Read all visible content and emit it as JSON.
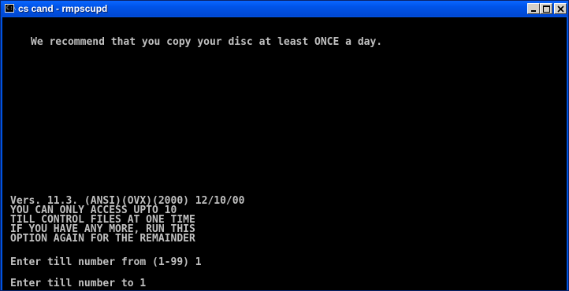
{
  "window": {
    "title": "cs cand - rmpscupd",
    "icon": "console-window-icon",
    "icon_glyph": "C:\\",
    "buttons": {
      "minimize": "minimize-icon",
      "maximize": "maximize-icon",
      "close": "close-icon"
    }
  },
  "console": {
    "recommendation": "We recommend that you copy your disc at least ONCE a day.",
    "version": "Vers. 11.3. (ANSI)(OVX)(2000) 12/10/00",
    "notice_lines": [
      "YOU CAN ONLY ACCESS UPTO 10",
      "TILL CONTROL FILES AT ONE TIME",
      "IF YOU HAVE ANY MORE, RUN THIS",
      "OPTION AGAIN FOR THE REMAINDER"
    ],
    "prompt_from": "Enter till number from (1-99) 1",
    "prompt_to": "Enter till number to 1"
  },
  "colors": {
    "titlebar": "#0055ea",
    "console_bg": "#000000",
    "console_fg": "#c0c0c0"
  }
}
